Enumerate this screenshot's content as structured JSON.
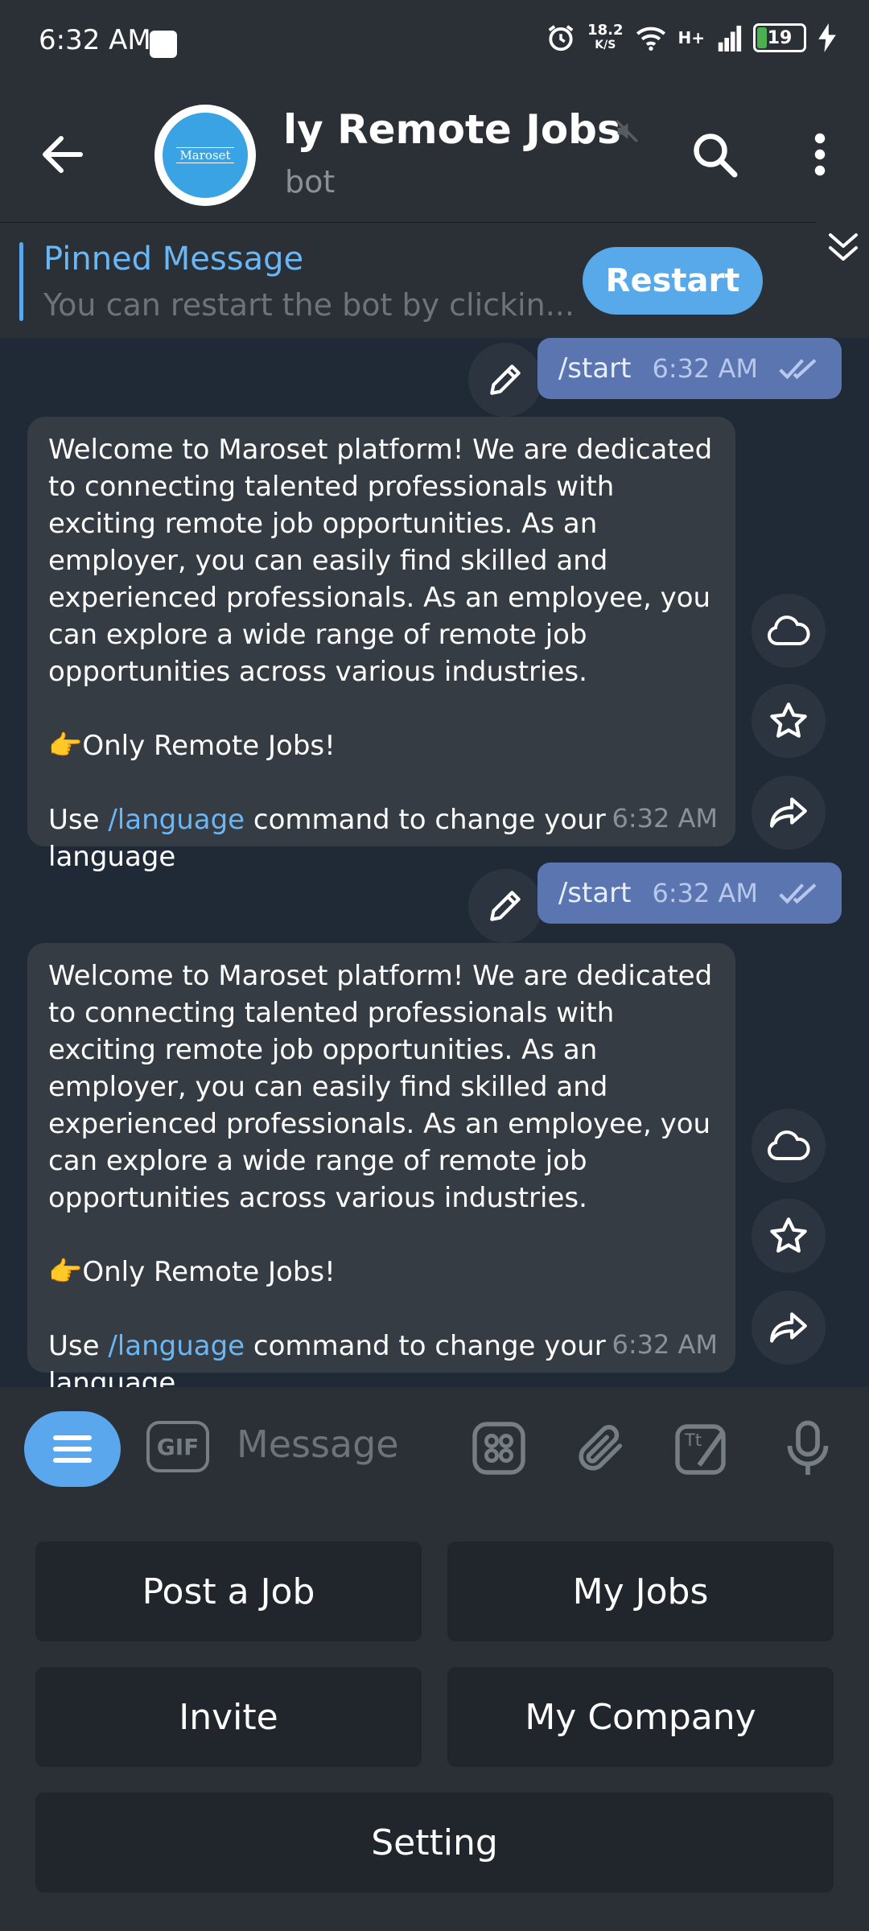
{
  "status_bar": {
    "time": "6:32 AM",
    "speed_value": "18.2",
    "speed_unit": "K/S",
    "network": "H+",
    "battery": "19"
  },
  "header": {
    "title": "ly Remote Jobs",
    "subtitle": "bot",
    "avatar_text": "Maroset"
  },
  "pinned": {
    "label": "Pinned Message",
    "text": "You can restart the bot by clickin...",
    "button": "Restart"
  },
  "messages": [
    {
      "type": "outgoing",
      "text": "/start",
      "time": "6:32 AM"
    },
    {
      "type": "incoming",
      "para1": "Welcome to Maroset platform! We are dedicated to connecting talented professionals with exciting remote job opportunities. As an employer, you can easily find skilled and experienced professionals. As an employee, you can explore a wide range of remote job opportunities across various industries.",
      "para2": "👉Only Remote Jobs!",
      "para3_pre": "Use ",
      "para3_link": "/language",
      "para3_post": " command to change your language",
      "time": "6:32 AM"
    },
    {
      "type": "outgoing",
      "text": "/start",
      "time": "6:32 AM"
    },
    {
      "type": "incoming",
      "para1": "Welcome to Maroset platform! We are dedicated to connecting talented professionals with exciting remote job opportunities. As an employer, you can easily find skilled and experienced professionals. As an employee, you can explore a wide range of remote job opportunities across various industries.",
      "para2": "👉Only Remote Jobs!",
      "para3_pre": "Use ",
      "para3_link": "/language",
      "para3_post": " command to change your language",
      "time": "6:32 AM"
    }
  ],
  "input": {
    "gif": "GIF",
    "placeholder": "Message"
  },
  "keyboard": {
    "post_job": "Post a Job",
    "my_jobs": "My Jobs",
    "invite": "Invite",
    "my_company": "My Company",
    "setting": "Setting"
  },
  "colors": {
    "accent": "#5aa7ee",
    "outgoing_bubble": "#5a75b0",
    "incoming_bubble": "#363c43",
    "header_bg": "#2b3036"
  }
}
